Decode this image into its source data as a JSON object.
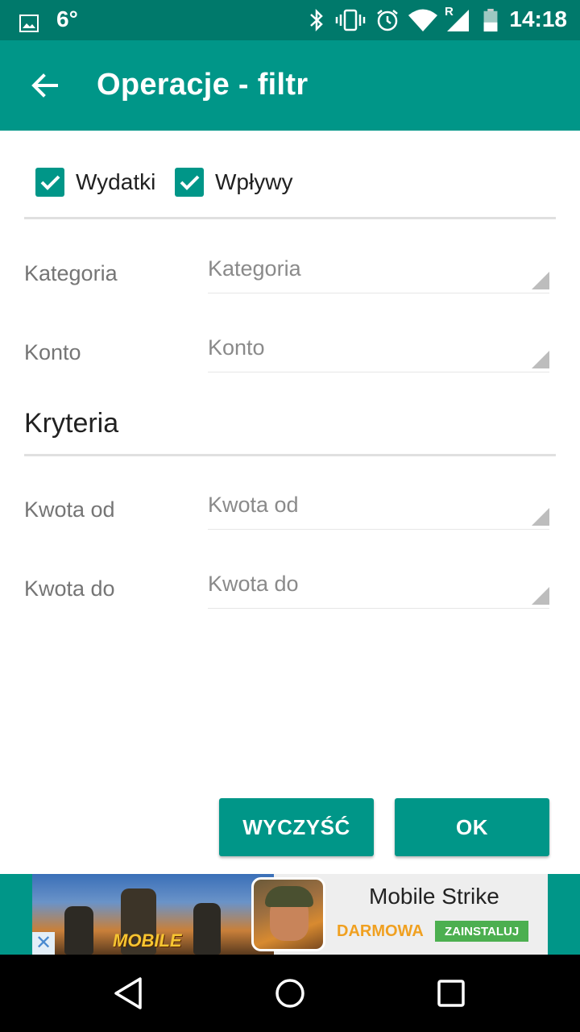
{
  "status_bar": {
    "temperature": "6°",
    "time": "14:18",
    "signal_roaming": "R",
    "icons": [
      "image-icon",
      "bluetooth-icon",
      "vibrate-icon",
      "alarm-icon",
      "wifi-icon",
      "signal-icon",
      "battery-icon"
    ]
  },
  "app_bar": {
    "title": "Operacje - filtr",
    "back_icon": "arrow-left-icon"
  },
  "filters": {
    "expenses": {
      "label": "Wydatki",
      "checked": true
    },
    "income": {
      "label": "Wpływy",
      "checked": true
    }
  },
  "fields": {
    "category": {
      "label": "Kategoria",
      "placeholder": "Kategoria"
    },
    "account": {
      "label": "Konto",
      "placeholder": "Konto"
    }
  },
  "criteria": {
    "title": "Kryteria",
    "amount_from": {
      "label": "Kwota od",
      "placeholder": "Kwota od"
    },
    "amount_to": {
      "label": "Kwota do",
      "placeholder": "Kwota do"
    }
  },
  "buttons": {
    "clear": "WYCZYŚĆ",
    "ok": "OK"
  },
  "ad": {
    "banner_logo": "MOBILE",
    "title": "Mobile Strike",
    "free_label": "DARMOWA",
    "install_label": "ZAINSTALUJ",
    "close_glyph": "✕"
  },
  "colors": {
    "primary": "#009688",
    "primary_dark": "#00796b",
    "install_green": "#4caf50",
    "free_orange": "#f0a020"
  }
}
